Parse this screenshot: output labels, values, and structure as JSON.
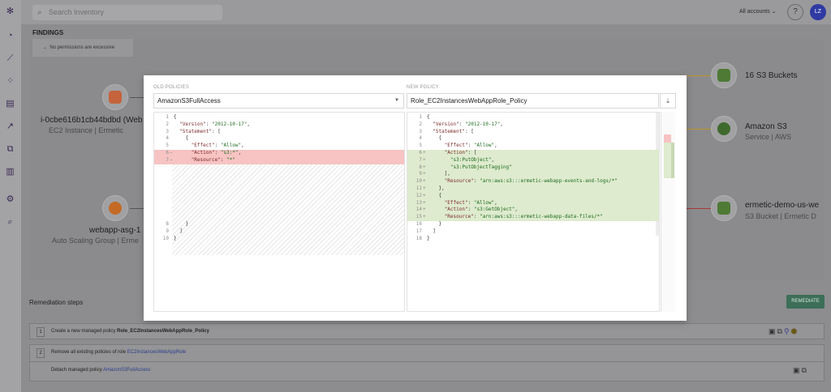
{
  "app": {
    "search_placeholder": "Search Inventory",
    "accounts_label": "All accounts",
    "help_label": "?",
    "avatar_initials": "LZ",
    "findings_title": "FINDINGS"
  },
  "graph": {
    "permissions_note": "No permissions are excessive",
    "nodes": {
      "instance_name": "i-0cbe616b1cb44bdbd (Web A",
      "instance_sub": "EC2 Instance | Ermetic",
      "asg_name": "webapp-asg-1",
      "asg_sub": "Auto Scaling Group | Erme",
      "buckets_label": "16 S3 Buckets",
      "s3_name": "Amazon S3",
      "s3_sub": "Service | AWS",
      "bucket_name": "ermetic-demo-us-we",
      "bucket_sub": "S3 Bucket | Ermetic D"
    }
  },
  "remediation": {
    "title": "Remediation steps",
    "button_label": "REMEDIATE",
    "steps": [
      {
        "num": "1",
        "text": "Create a new managed policy ",
        "bold": "Role_EC2InstancesWebAppRole_Policy"
      },
      {
        "num": "2",
        "text": "Remove all existing policies of role ",
        "link": "EC2InstancesWebAppRole"
      },
      {
        "num": "",
        "text": "Detach managed policy ",
        "link": "AmazonS3FullAccess"
      }
    ]
  },
  "modal": {
    "old_header": "OLD POLICIES",
    "new_header": "NEW POLICY",
    "old_select": "AmazonS3FullAccess",
    "new_select": "Role_EC2InstancesWebAppRole_Policy",
    "colors": {
      "deleted": "#f7c3c3",
      "added": "#deebce"
    },
    "old_lines": [
      {
        "n": "1",
        "m": "",
        "t": "{",
        "type": ""
      },
      {
        "n": "2",
        "m": "",
        "t": "  \"Version\": \"2012-10-17\",",
        "type": ""
      },
      {
        "n": "3",
        "m": "",
        "t": "  \"Statement\": [",
        "type": ""
      },
      {
        "n": "4",
        "m": "",
        "t": "    {",
        "type": ""
      },
      {
        "n": "5",
        "m": "",
        "t": "      \"Effect\": \"Allow\",",
        "type": ""
      },
      {
        "n": "6",
        "m": "−",
        "t": "      \"Action\": \"s3:*\",",
        "type": "del"
      },
      {
        "n": "7",
        "m": "−",
        "t": "      \"Resource\": \"*\"",
        "type": "del"
      }
    ],
    "old_tail": [
      {
        "n": "8",
        "m": "",
        "t": "    }",
        "type": ""
      },
      {
        "n": "9",
        "m": "",
        "t": "  ]",
        "type": ""
      },
      {
        "n": "10",
        "m": "",
        "t": "}",
        "type": ""
      }
    ],
    "new_lines": [
      {
        "n": "1",
        "m": "",
        "t": "{",
        "type": ""
      },
      {
        "n": "2",
        "m": "",
        "t": "  \"Version\": \"2012-10-17\",",
        "type": ""
      },
      {
        "n": "3",
        "m": "",
        "t": "  \"Statement\": [",
        "type": ""
      },
      {
        "n": "4",
        "m": "",
        "t": "    {",
        "type": ""
      },
      {
        "n": "5",
        "m": "",
        "t": "      \"Effect\": \"Allow\",",
        "type": ""
      },
      {
        "n": "6",
        "m": "+",
        "t": "      \"Action\": [",
        "type": "add"
      },
      {
        "n": "7",
        "m": "+",
        "t": "        \"s3:PutObject\",",
        "type": "add"
      },
      {
        "n": "8",
        "m": "+",
        "t": "        \"s3:PutObjectTagging\"",
        "type": "add"
      },
      {
        "n": "9",
        "m": "+",
        "t": "      ],",
        "type": "add"
      },
      {
        "n": "10",
        "m": "+",
        "t": "      \"Resource\": \"arn:aws:s3:::ermetic-webapp-events-and-logs/*\"",
        "type": "add"
      },
      {
        "n": "11",
        "m": "+",
        "t": "    },",
        "type": "add"
      },
      {
        "n": "12",
        "m": "+",
        "t": "    {",
        "type": "add"
      },
      {
        "n": "13",
        "m": "+",
        "t": "      \"Effect\": \"Allow\",",
        "type": "add"
      },
      {
        "n": "14",
        "m": "+",
        "t": "      \"Action\": \"s3:GetObject\",",
        "type": "add"
      },
      {
        "n": "15",
        "m": "+",
        "t": "      \"Resource\": \"arn:aws:s3:::ermetic-webapp-data-files/*\"",
        "type": "add"
      },
      {
        "n": "16",
        "m": "",
        "t": "    }",
        "type": ""
      },
      {
        "n": "17",
        "m": "",
        "t": "  ]",
        "type": ""
      },
      {
        "n": "18",
        "m": "",
        "t": "}",
        "type": ""
      }
    ]
  }
}
